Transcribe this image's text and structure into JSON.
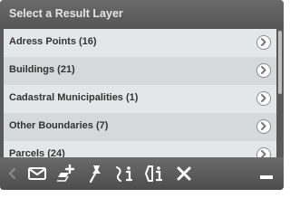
{
  "panel": {
    "title": "Select a Result Layer"
  },
  "layers": [
    {
      "label": "Adress Points (16)"
    },
    {
      "label": "Buildings (21)"
    },
    {
      "label": "Cadastral Municipalities (1)"
    },
    {
      "label": "Other Boundaries (7)"
    },
    {
      "label": "Parcels (24)"
    }
  ],
  "toolbar": {
    "icons": [
      "back-arrow-icon",
      "email-icon",
      "add-layer-icon",
      "pin-icon",
      "identify-icon",
      "polyline-identify-icon",
      "close-icon",
      "minimize-icon"
    ]
  },
  "colors": {
    "header_bg": "#5f5f5f",
    "row_light": "#e4e7e7",
    "row_dark": "#d5d9d9",
    "toolbar_bg": "#5a5a5a",
    "text": "#333333"
  }
}
